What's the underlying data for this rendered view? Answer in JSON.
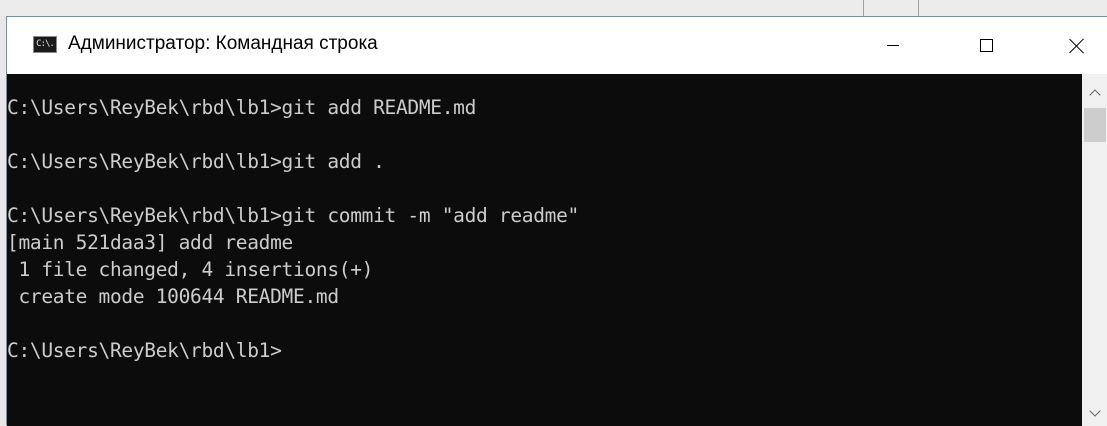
{
  "window": {
    "title": "Администратор: Командная строка",
    "icon_text": "C:\\."
  },
  "controls": {
    "minimize": "minimize-icon",
    "maximize": "maximize-icon",
    "close": "close-icon"
  },
  "console": {
    "lines": [
      "C:\\Users\\ReyBek\\rbd\\lb1>git add README.md",
      "",
      "C:\\Users\\ReyBek\\rbd\\lb1>git add .",
      "",
      "C:\\Users\\ReyBek\\rbd\\lb1>git commit -m \"add readme\"",
      "[main 521daa3] add readme",
      " 1 file changed, 4 insertions(+)",
      " create mode 100644 README.md",
      "",
      "C:\\Users\\ReyBek\\rbd\\lb1>"
    ]
  },
  "colors": {
    "console_bg": "#0c0c0c",
    "console_fg": "#cccccc",
    "titlebar_bg": "#ffffff",
    "scrollbar_bg": "#f0f0f0"
  }
}
